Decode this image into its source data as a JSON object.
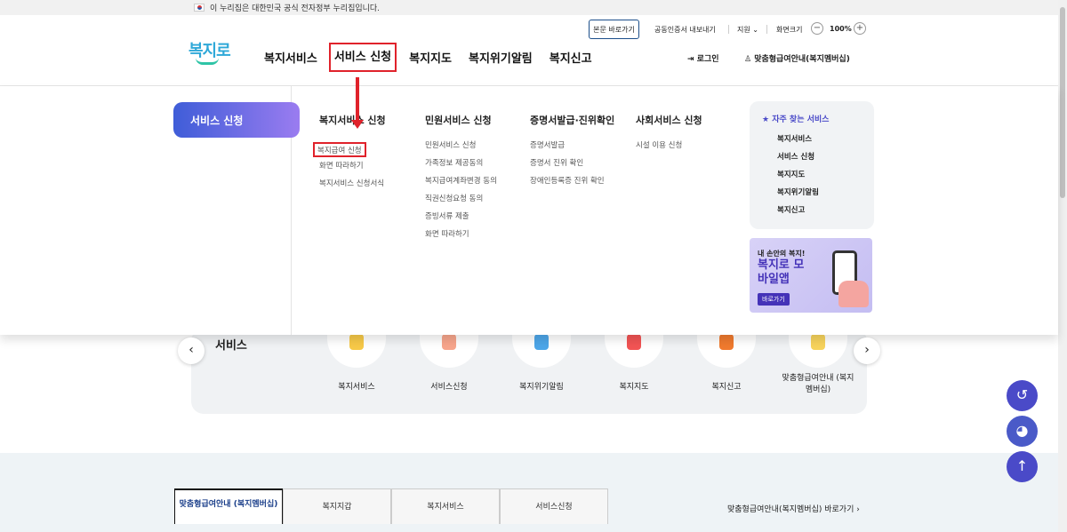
{
  "gov_bar": {
    "text": "이 누리집은 대한민국 공식 전자정부 누리집입니다."
  },
  "header": {
    "logo_text": "복지로",
    "gnb": [
      "복지서비스",
      "서비스 신청",
      "복지지도",
      "복지위기알림",
      "복지신고"
    ],
    "skip_label": "본문 바로가기",
    "cert_label": "공동인증서 내보내기",
    "support_label": "지원",
    "fontsize_label": "화면크기",
    "zoom_value": "100%",
    "minus": "−",
    "plus": "+",
    "login_label": "로그인",
    "member_label": "맞춤형급여안내(복지멤버십)"
  },
  "mega_menu": {
    "side_title": "서비스 신청",
    "columns": [
      {
        "title": "복지서비스 신청",
        "items": [
          "복지급여 신청",
          "화면 따라하기",
          "복지서비스 신청서식"
        ]
      },
      {
        "title": "민원서비스 신청",
        "items": [
          "민원서비스 신청",
          "가족정보 제공동의",
          "복지급여계좌변경 동의",
          "직권신청요청 동의",
          "증빙서류 제출",
          "화면 따라하기"
        ]
      },
      {
        "title": "증명서발급·진위확인",
        "items": [
          "증명서발급",
          "증명서 진위 확인",
          "장애인등록증 진위 확인"
        ]
      },
      {
        "title": "사회서비스 신청",
        "items": [
          "시설 이용 신청"
        ]
      }
    ],
    "faq": {
      "title": "자주 찾는 서비스",
      "items": [
        "복지서비스",
        "서비스 신청",
        "복지지도",
        "복지위기알림",
        "복지신고"
      ]
    },
    "banner": {
      "line1": "내 손안의 복지!",
      "line2": "복지로 모바일앱",
      "button": "바로가기"
    }
  },
  "services": {
    "title": "서비스",
    "items": [
      "복지서비스",
      "서비스신청",
      "복지위기알림",
      "복지지도",
      "복지신고",
      "맞춤형급여안내 (복지멤버십)"
    ],
    "prev": "‹",
    "next": "›"
  },
  "fabs": {
    "history": "↺",
    "chatbot": "◕",
    "top": "↑"
  },
  "tabs": {
    "items": [
      "맞춤형급여안내 (복지멤버십)",
      "복지지갑",
      "복지서비스",
      "서비스신청"
    ],
    "more": "맞춤형급여안내(복지멤버십) 바로가기 ›"
  },
  "colors": {
    "accent": "#e0222b",
    "brand": "#3f5dd8",
    "fab": "#4a4ac8"
  }
}
